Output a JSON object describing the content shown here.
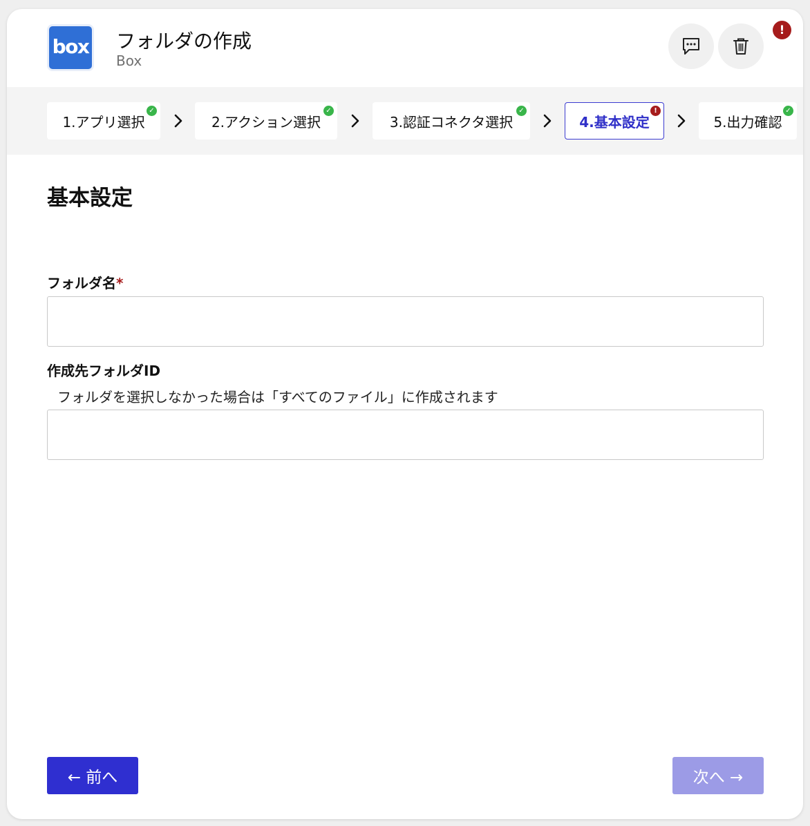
{
  "header": {
    "app_logo_text": "box",
    "title": "フォルダの作成",
    "subtitle": "Box",
    "comment_icon": "comment-icon",
    "delete_icon": "trash-icon",
    "error_indicator": "!"
  },
  "stepper": {
    "steps": [
      {
        "label": "1.アプリ選択",
        "status": "complete",
        "badge": "✓"
      },
      {
        "label": "2.アクション選択",
        "status": "complete",
        "badge": "✓"
      },
      {
        "label": "3.認証コネクタ選択",
        "status": "complete",
        "badge": "✓"
      },
      {
        "label": "4.基本設定",
        "status": "error",
        "badge": "!"
      },
      {
        "label": "5.出力確認",
        "status": "complete",
        "badge": "✓"
      }
    ]
  },
  "main": {
    "section_title": "基本設定",
    "fields": [
      {
        "label": "フォルダ名",
        "required_mark": "*",
        "value": "",
        "placeholder": ""
      },
      {
        "label": "作成先フォルダID",
        "hint": "フォルダを選択しなかった場合は「すべてのファイル」に作成されます",
        "value": "",
        "placeholder": ""
      }
    ]
  },
  "footer": {
    "prev_label": "← 前へ",
    "next_label": "次へ →"
  },
  "colors": {
    "primary": "#2f2fd0",
    "primary_disabled": "#9c9be6",
    "error": "#a61c1c",
    "success": "#39b54a",
    "box_blue": "#2f6fd6"
  }
}
